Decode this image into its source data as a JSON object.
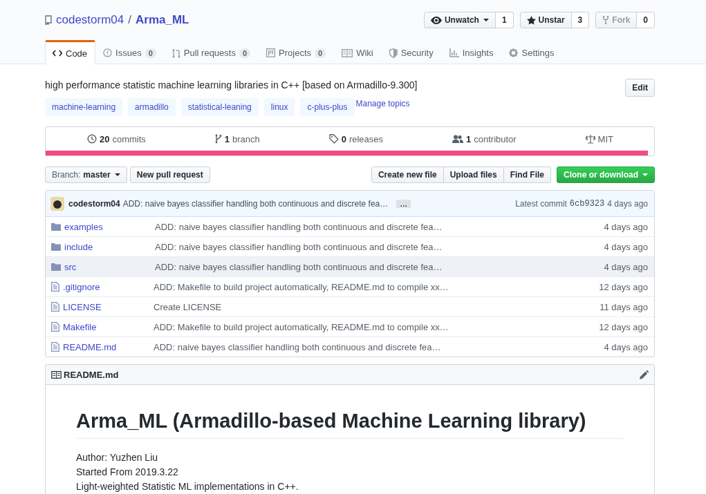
{
  "repo": {
    "owner": "codestorm04",
    "separator": "/",
    "name": "Arma_ML"
  },
  "actions": [
    {
      "kind": "watch",
      "label": "Unwatch",
      "count": "1",
      "disabled": false,
      "dropdown": true
    },
    {
      "kind": "star",
      "label": "Unstar",
      "count": "3",
      "disabled": false,
      "dropdown": false
    },
    {
      "kind": "fork",
      "label": "Fork",
      "count": "0",
      "disabled": true,
      "dropdown": false
    }
  ],
  "tabs": [
    {
      "kind": "code",
      "label": "Code",
      "selected": true
    },
    {
      "kind": "issues",
      "label": "Issues",
      "counter": "0",
      "selected": false
    },
    {
      "kind": "pulls",
      "label": "Pull requests",
      "counter": "0",
      "selected": false
    },
    {
      "kind": "projects",
      "label": "Projects",
      "counter": "0",
      "selected": false
    },
    {
      "kind": "wiki",
      "label": "Wiki",
      "selected": false
    },
    {
      "kind": "security",
      "label": "Security",
      "selected": false
    },
    {
      "kind": "insights",
      "label": "Insights",
      "selected": false
    },
    {
      "kind": "settings",
      "label": "Settings",
      "selected": false
    }
  ],
  "description": "high performance statistic machine learning libraries in C++ [based on Armadillo-9.300]",
  "edit_button": "Edit",
  "topics": [
    "machine-learning",
    "armadillo",
    "statistical-leaning",
    "linux",
    "c-plus-plus"
  ],
  "manage_topics": "Manage topics",
  "summary": [
    {
      "kind": "commits",
      "count": "20",
      "label": "commits"
    },
    {
      "kind": "branch",
      "count": "1",
      "label": "branch"
    },
    {
      "kind": "releases",
      "count": "0",
      "label": "releases"
    },
    {
      "kind": "contributors",
      "count": "1",
      "label": "contributor"
    },
    {
      "kind": "license",
      "label": "MIT"
    }
  ],
  "language_bar": [
    {
      "color": "#f34b7d",
      "level": 1
    }
  ],
  "branch": {
    "label": "Branch:",
    "value": "master"
  },
  "new_pull_request": "New pull request",
  "file_buttons": [
    "Create new file",
    "Upload files",
    "Find File"
  ],
  "clone_button": "Clone or download",
  "latest_commit": {
    "author": "codestorm04",
    "message": "ADD: naive bayes classifier handling both continuous and discrete fea…",
    "ellipsis": "…",
    "label": "Latest commit",
    "sha": "6cb9323",
    "age": "4 days ago"
  },
  "files": [
    {
      "kind": "dir",
      "name": "examples",
      "message": "ADD: naive bayes classifier handling both continuous and discrete fea…",
      "age": "4 days ago",
      "highlighted": false
    },
    {
      "kind": "dir",
      "name": "include",
      "message": "ADD: naive bayes classifier handling both continuous and discrete fea…",
      "age": "4 days ago",
      "highlighted": false
    },
    {
      "kind": "dir",
      "name": "src",
      "message": "ADD: naive bayes classifier handling both continuous and discrete fea…",
      "age": "4 days ago",
      "highlighted": true
    },
    {
      "kind": "file",
      "name": ".gitignore",
      "message": "ADD: Makefile to build project automatically, README.md to compile xx…",
      "age": "12 days ago",
      "highlighted": false
    },
    {
      "kind": "file",
      "name": "LICENSE",
      "message": "Create LICENSE",
      "age": "11 days ago",
      "highlighted": false
    },
    {
      "kind": "file",
      "name": "Makefile",
      "message": "ADD: Makefile to build project automatically, README.md to compile xx…",
      "age": "12 days ago",
      "highlighted": false
    },
    {
      "kind": "file",
      "name": "README.md",
      "message": "ADD: naive bayes classifier handling both continuous and discrete fea…",
      "age": "4 days ago",
      "highlighted": false
    }
  ],
  "readme": {
    "filename": "README.md",
    "heading": "Arma_ML (Armadillo-based Machine Learning library)",
    "lines": [
      "Author: Yuzhen Liu",
      "Started From 2019.3.22",
      "Light-weighted Statistic ML implementations in C++."
    ]
  }
}
